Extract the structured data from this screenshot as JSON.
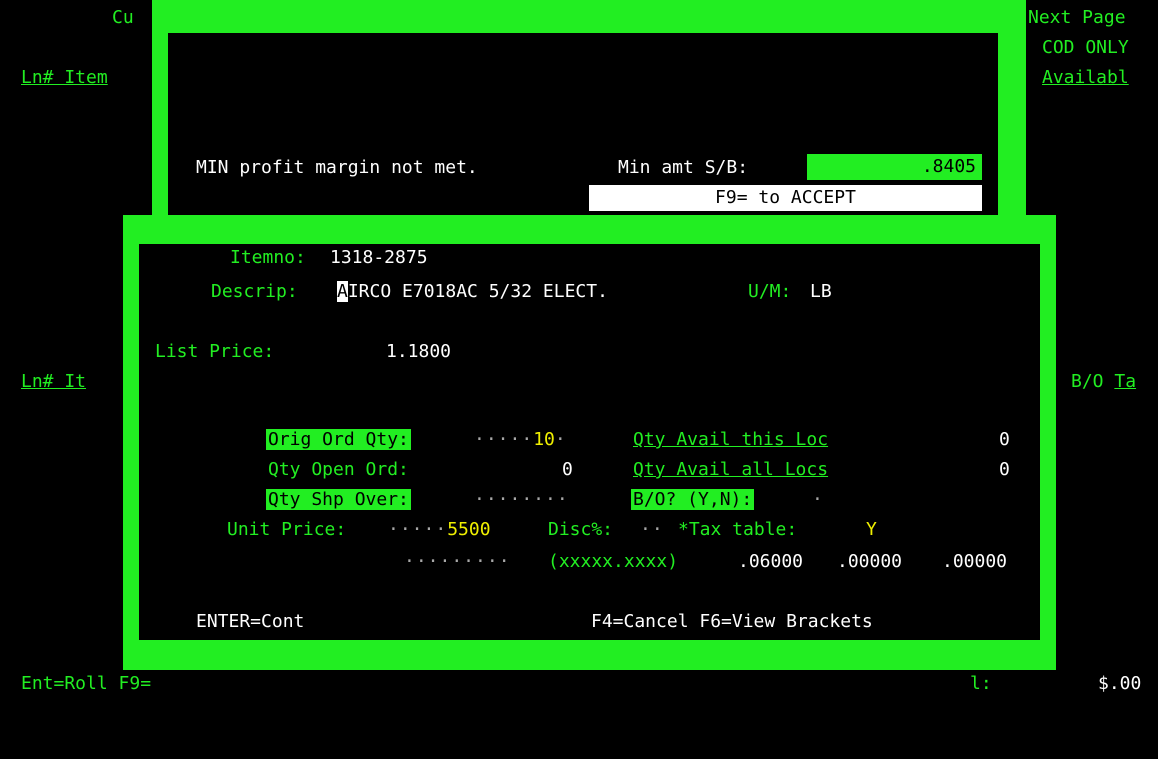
{
  "background": {
    "top_left_cu": "Cu",
    "next_page": "Next Page",
    "cod_only": "COD ONLY",
    "ln_item_header": "Ln# Item",
    "available_header": "Availabl",
    "ln_it_header": "Ln# It",
    "bo_ta_header": "B/O Ta",
    "footer_left": "Ent=Roll F9=",
    "footer_l": "l:",
    "footer_amount": "$.00"
  },
  "margin_popup": {
    "message": "MIN profit margin not met.",
    "min_amt_label": "Min amt S/B:",
    "min_amt_value": ".8405",
    "accept_hint": "F9= to ACCEPT"
  },
  "item_popup": {
    "itemno_label": "Itemno:",
    "itemno_value": "1318-2875",
    "descrip_label": "Descrip:",
    "descrip_cursor": "A",
    "descrip_value": "IRCO E7018AC 5/32 ELECT.",
    "um_label": "U/M:",
    "um_value": "LB",
    "list_price_label": "List Price:",
    "list_price_value": "1.1800",
    "orig_ord_qty_label": "Orig Ord Qty:",
    "orig_ord_qty_value": "10",
    "qty_open_ord_label": "Qty Open Ord:",
    "qty_open_ord_value": "0",
    "qty_shp_over_label": "Qty Shp Over:",
    "qty_avail_loc_label": "Qty Avail this Loc",
    "qty_avail_loc_value": "0",
    "qty_avail_all_label": "Qty Avail all Locs",
    "qty_avail_all_value": "0",
    "bo_label": "B/O? (Y,N):",
    "unit_price_label": "Unit Price:",
    "unit_price_value": "5500",
    "disc_label": "Disc%:",
    "tax_table_label": "*Tax table:",
    "tax_table_value": "Y",
    "format_hint": "(xxxxx.xxxx)",
    "tax_rate_1": ".06000",
    "tax_rate_2": ".00000",
    "tax_rate_3": ".00000",
    "enter_hint": "ENTER=Cont",
    "function_keys": "F4=Cancel F6=View Brackets"
  },
  "colors": {
    "green": "#22ee22",
    "white": "#ffffff",
    "yellow": "#f0f000",
    "gray": "#a8a8a8"
  }
}
